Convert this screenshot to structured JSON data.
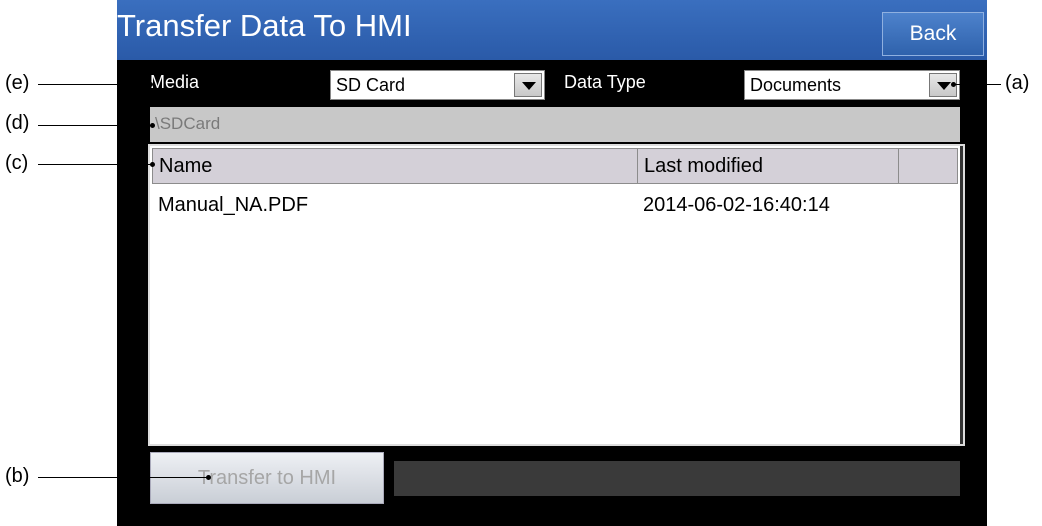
{
  "window": {
    "title": "Transfer Data To HMI",
    "back_label": "Back"
  },
  "media": {
    "label": "Media",
    "value": "SD Card"
  },
  "data_type": {
    "label": "Data Type",
    "value": "Documents"
  },
  "path": "\\SDCard",
  "file_list": {
    "columns": [
      "Name",
      "Last modified"
    ],
    "rows": [
      {
        "name": "Manual_NA.PDF",
        "modified": "2014-06-02-16:40:14"
      }
    ]
  },
  "transfer_button": "Transfer to HMI",
  "callouts": {
    "a": "(a)",
    "b": "(b)",
    "c": "(c)",
    "d": "(d)",
    "e": "(e)"
  }
}
